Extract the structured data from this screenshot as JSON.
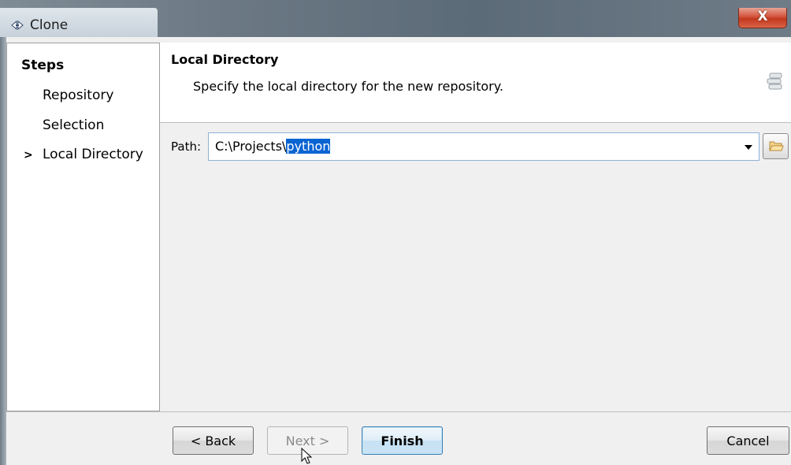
{
  "window": {
    "title": "Clone",
    "close_label": "X"
  },
  "steps": {
    "title": "Steps",
    "items": [
      {
        "label": "Repository",
        "current": false
      },
      {
        "label": "Selection",
        "current": false
      },
      {
        "label": "Local Directory",
        "current": true
      }
    ],
    "current_marker": ">"
  },
  "header": {
    "title": "Local Directory",
    "description": "Specify the local directory for the new repository.",
    "icon": "wizard-banner-icon"
  },
  "path": {
    "label": "Path:",
    "value_prefix": "C:\\Projects\\",
    "value_selected": "python"
  },
  "buttons": {
    "back": "< Back",
    "next": "Next >",
    "finish": "Finish",
    "cancel": "Cancel"
  },
  "colors": {
    "selection": "#0a64d2",
    "close_button": "#c2381f",
    "default_button_border": "#3c7fb1"
  }
}
